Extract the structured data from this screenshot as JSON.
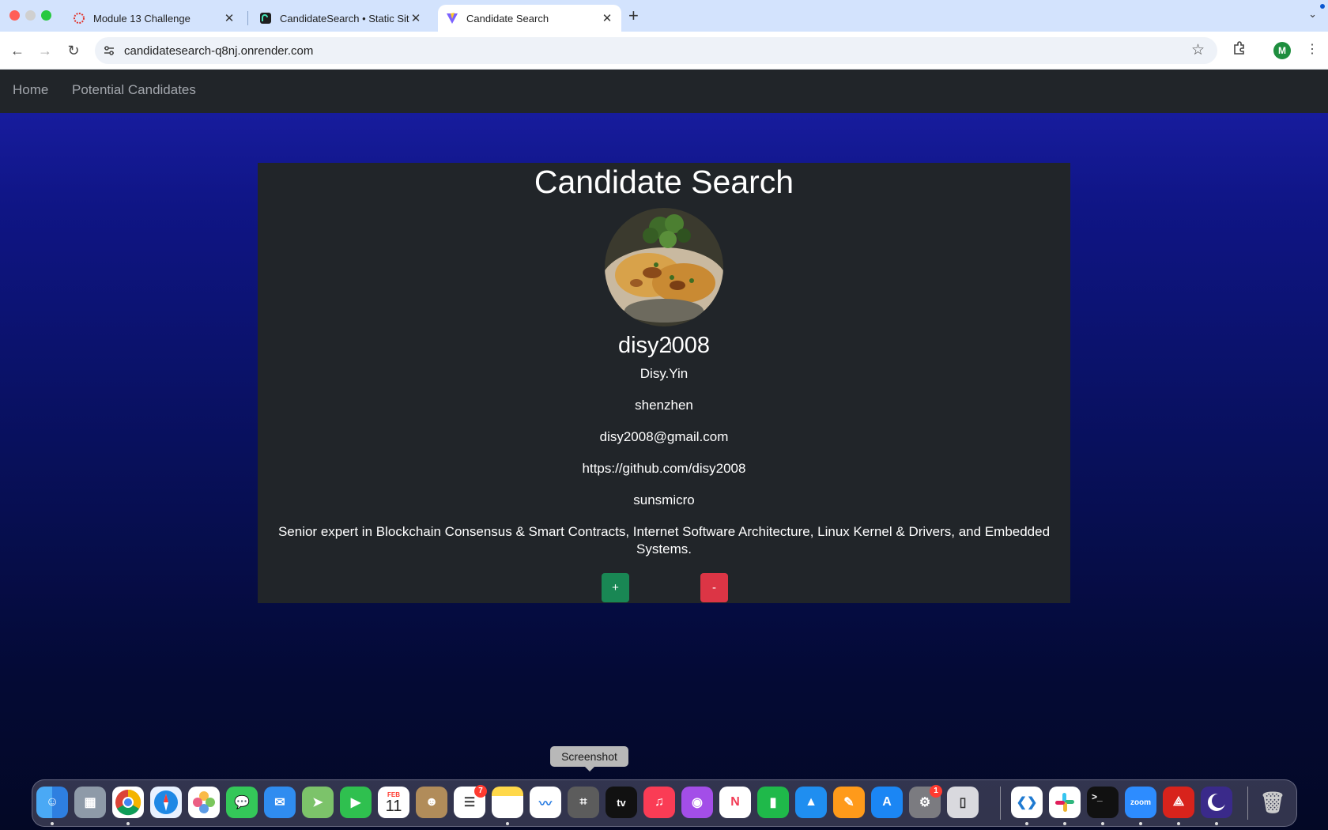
{
  "browser": {
    "tabs": [
      {
        "title": "Module 13 Challenge",
        "favicon": "canvas-ring-icon"
      },
      {
        "title": "CandidateSearch • Static Site",
        "favicon": "render-icon"
      },
      {
        "title": "Candidate Search",
        "favicon": "vite-icon"
      }
    ],
    "url": "candidatesearch-q8nj.onrender.com",
    "profile_initial": "M"
  },
  "site": {
    "nav": {
      "home": "Home",
      "potential": "Potential Candidates"
    },
    "title": "Candidate Search",
    "candidate": {
      "username": "disy2008",
      "name": "Disy.Yin",
      "location": "shenzhen",
      "email": "disy2008@gmail.com",
      "html_url": "https://github.com/disy2008",
      "company": "sunsmicro",
      "bio": "Senior expert in Blockchain Consensus & Smart Contracts, Internet Software Architecture, Linux Kernel & Drivers, and Embedded Systems."
    },
    "buttons": {
      "add": "+",
      "remove": "-"
    },
    "colors": {
      "add": "#198754",
      "remove": "#dc3545",
      "card": "#212529"
    }
  },
  "dock": {
    "tooltip": "Screenshot",
    "calendar_month": "FEB",
    "calendar_day": "11",
    "reminders_badge": "7",
    "settings_badge": "1",
    "apps": [
      "finder-icon",
      "launchpad-icon",
      "chrome-icon",
      "safari-icon",
      "photos-icon",
      "messages-icon",
      "mail-icon",
      "maps-icon",
      "facetime-icon",
      "calendar-icon",
      "contacts-icon",
      "reminders-icon",
      "notes-icon",
      "freeform-icon",
      "screenshot-icon",
      "apple-tv-icon",
      "music-icon",
      "podcasts-icon",
      "news-icon",
      "numbers-icon",
      "keynote-icon",
      "pages-icon",
      "app-store-icon",
      "system-settings-icon",
      "iphone-mirroring-icon",
      "vscode-icon",
      "slack-icon",
      "terminal-icon",
      "zoom-icon",
      "acrobat-icon",
      "vpn-icon",
      "trash-icon"
    ],
    "tv_label": "tv",
    "zoom_label": "zoom"
  }
}
